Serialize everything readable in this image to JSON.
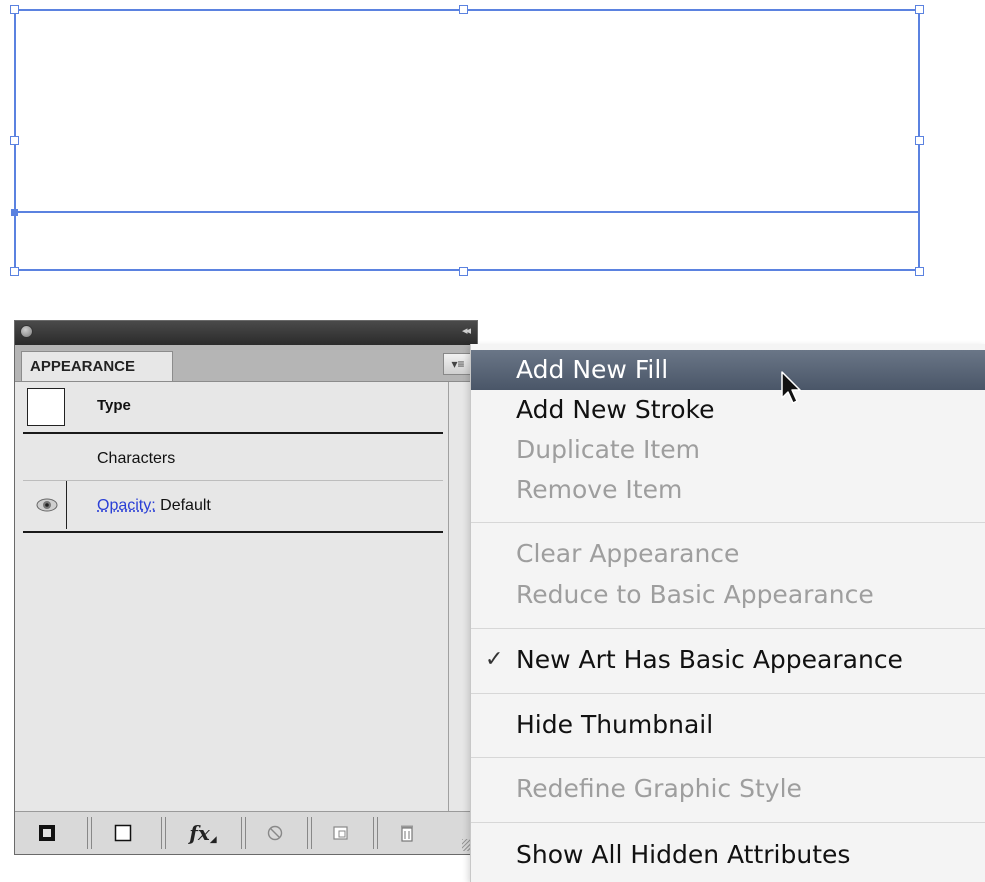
{
  "panel": {
    "tab_label": "APPEARANCE",
    "collapse_icon": "◂◂",
    "menu_icon": "▾≡",
    "rows": {
      "type_label": "Type",
      "characters_label": "Characters",
      "opacity_label": "Opacity:",
      "opacity_value": "Default"
    },
    "bottom_icons": [
      "add-new-stroke-icon",
      "add-new-fill-icon",
      "add-effect-icon",
      "clear-appearance-icon",
      "duplicate-item-icon",
      "delete-item-icon"
    ],
    "fx_label": "fx"
  },
  "menu": {
    "items": [
      {
        "label": "Add New Fill",
        "state": "hover"
      },
      {
        "label": "Add New Stroke",
        "state": "enabled"
      },
      {
        "label": "Duplicate Item",
        "state": "disabled"
      },
      {
        "label": "Remove Item",
        "state": "disabled"
      },
      {
        "label": "Clear Appearance",
        "state": "disabled"
      },
      {
        "label": "Reduce to Basic Appearance",
        "state": "disabled"
      },
      {
        "label": "New Art Has Basic Appearance",
        "state": "checked"
      },
      {
        "label": "Hide Thumbnail",
        "state": "enabled"
      },
      {
        "label": "Redefine Graphic Style",
        "state": "disabled"
      },
      {
        "label": "Show All Hidden Attributes",
        "state": "enabled"
      }
    ],
    "check_mark": "✓"
  },
  "colors": {
    "selection": "#5b82e0",
    "menu_hover": "#56627a",
    "disabled_text": "#9e9e9e",
    "link": "#2a3fd6"
  }
}
